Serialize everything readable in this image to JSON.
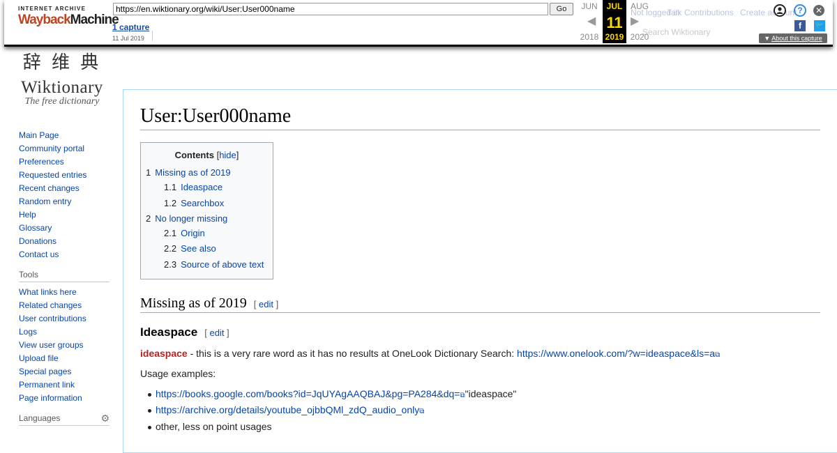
{
  "wayback": {
    "logo_top": "INTERNET ARCHIVE",
    "logo_w": "Wayback",
    "logo_m": "Machine",
    "url": "https://en.wiktionary.org/wiki/User:User000name",
    "go": "Go",
    "captures": "1 capture",
    "capture_date": "11 Jul 2019",
    "months": [
      "JUN",
      "JUL",
      "AUG"
    ],
    "day": "11",
    "years": [
      "2018",
      "2019",
      "2020"
    ],
    "about": "About this capture",
    "ghost_links": [
      "Not logged in",
      "Talk",
      "Contributions",
      "Create account"
    ],
    "ghost_search": "Search Wiktionary"
  },
  "site": {
    "glyphs": "辞 维 典",
    "name": "Wiktionary",
    "tagline": "The free dictionary"
  },
  "nav": {
    "main": [
      "Main Page",
      "Community portal",
      "Preferences",
      "Requested entries",
      "Recent changes",
      "Random entry",
      "Help",
      "Glossary",
      "Donations",
      "Contact us"
    ],
    "tools_heading": "Tools",
    "tools": [
      "What links here",
      "Related changes",
      "User contributions",
      "Logs",
      "View user groups",
      "Upload file",
      "Special pages",
      "Permanent link",
      "Page information"
    ],
    "languages_heading": "Languages"
  },
  "page": {
    "title": "User:User000name",
    "toc": {
      "title": "Contents",
      "hide": "hide",
      "items": [
        {
          "num": "1",
          "label": "Missing as of 2019"
        },
        {
          "num": "1.1",
          "label": "Ideaspace"
        },
        {
          "num": "1.2",
          "label": "Searchbox"
        },
        {
          "num": "2",
          "label": "No longer missing"
        },
        {
          "num": "2.1",
          "label": "Origin"
        },
        {
          "num": "2.2",
          "label": "See also"
        },
        {
          "num": "2.3",
          "label": "Source of above text"
        }
      ]
    },
    "section1": "Missing as of 2019",
    "edit": "edit",
    "subsection1": "Ideaspace",
    "word": "ideaspace",
    "desc": " - this is a very rare word as it has no results at OneLook Dictionary Search: ",
    "onelook": "https://www.onelook.com/?w=ideaspace&ls=a",
    "usage": "Usage examples:",
    "examples": [
      {
        "link": "https://books.google.com/books?id=JqUYAgAAQBAJ&pg=PA284&dq=",
        "after": "\"ideaspace\""
      },
      {
        "link": "https://archive.org/details/youtube_ojbbQMl_zdQ_audio_only",
        "after": ""
      },
      {
        "link": "",
        "after": "other, less on point usages"
      }
    ]
  }
}
